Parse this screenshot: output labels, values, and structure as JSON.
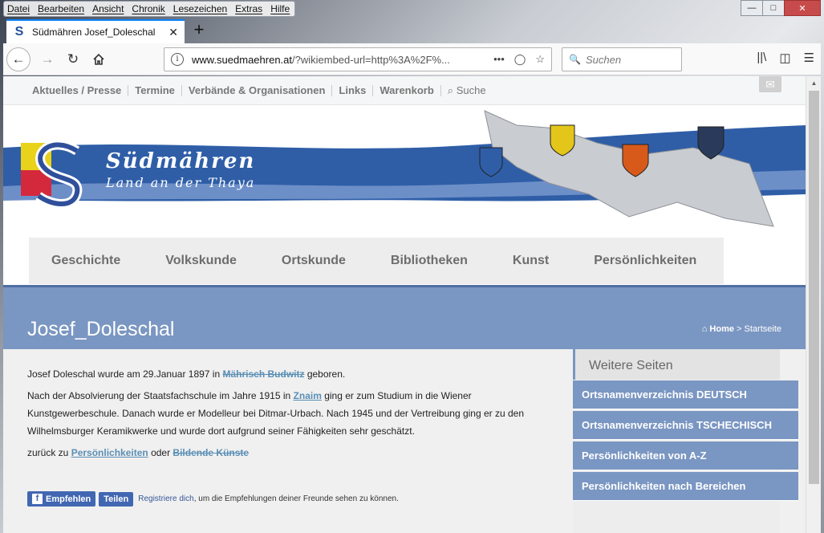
{
  "menubar": [
    "Datei",
    "Bearbeiten",
    "Ansicht",
    "Chronik",
    "Lesezeichen",
    "Extras",
    "Hilfe"
  ],
  "tab": {
    "title": "Südmähren Josef_Doleschal"
  },
  "urlbar": {
    "domain": "www.suedmaehren.at",
    "path": "/?wikiembed-url=http%3A%2F%..."
  },
  "search": {
    "placeholder": "Suchen"
  },
  "topnav": {
    "links": [
      "Aktuelles / Presse",
      "Termine",
      "Verbände & Organisationen",
      "Links",
      "Warenkorb"
    ],
    "search": "Suche"
  },
  "banner": {
    "title": "Südmähren",
    "subtitle": "Land an der Thaya"
  },
  "navmenu": [
    "Geschichte",
    "Volkskunde",
    "Ortskunde",
    "Bibliotheken",
    "Kunst",
    "Persönlichkeiten"
  ],
  "page": {
    "heading": "Josef_Doleschal",
    "crumb_home": "Home",
    "crumb_sep": ">",
    "crumb_current": "Startseite"
  },
  "content": {
    "p1_a": "Josef Doleschal wurde am 29.Januar 1897 in ",
    "p1_link": "Mährisch Budwitz",
    "p1_b": " geboren.",
    "p2_a": "Nach der Absolvierung der Staatsfachschule im Jahre 1915 in ",
    "p2_link": "Znaim",
    "p2_b": " ging er zum Studium in die Wiener Kunstgewerbeschule. Danach wurde er Modelleur bei Ditmar-Urbach. Nach 1945 und der Vertreibung ging er zu den Wilhelmsburger Keramikwerke und wurde dort aufgrund seiner Fähigkeiten sehr geschätzt.",
    "p3_a": "zurück zu ",
    "p3_link1": "Persönlichkeiten",
    "p3_b": " oder ",
    "p3_link2": "Bildende Künste"
  },
  "fb": {
    "like": "Empfehlen",
    "share": "Teilen",
    "register": "Registriere dich",
    "text": ", um die Empfehlungen deiner Freunde sehen zu können."
  },
  "sidebar": {
    "heading": "Weitere Seiten",
    "items": [
      "Ortsnamenverzeichnis DEUTSCH",
      "Ortsnamenverzeichnis TSCHECHISCH",
      "Persönlichkeiten von A-Z",
      "Persönlichkeiten nach Bereichen"
    ]
  },
  "colors": {
    "accent": "#7a96c2",
    "link": "#5a8fb5",
    "banner_blue": "#2f5ea7",
    "tab_accent": "#0a84ff"
  }
}
